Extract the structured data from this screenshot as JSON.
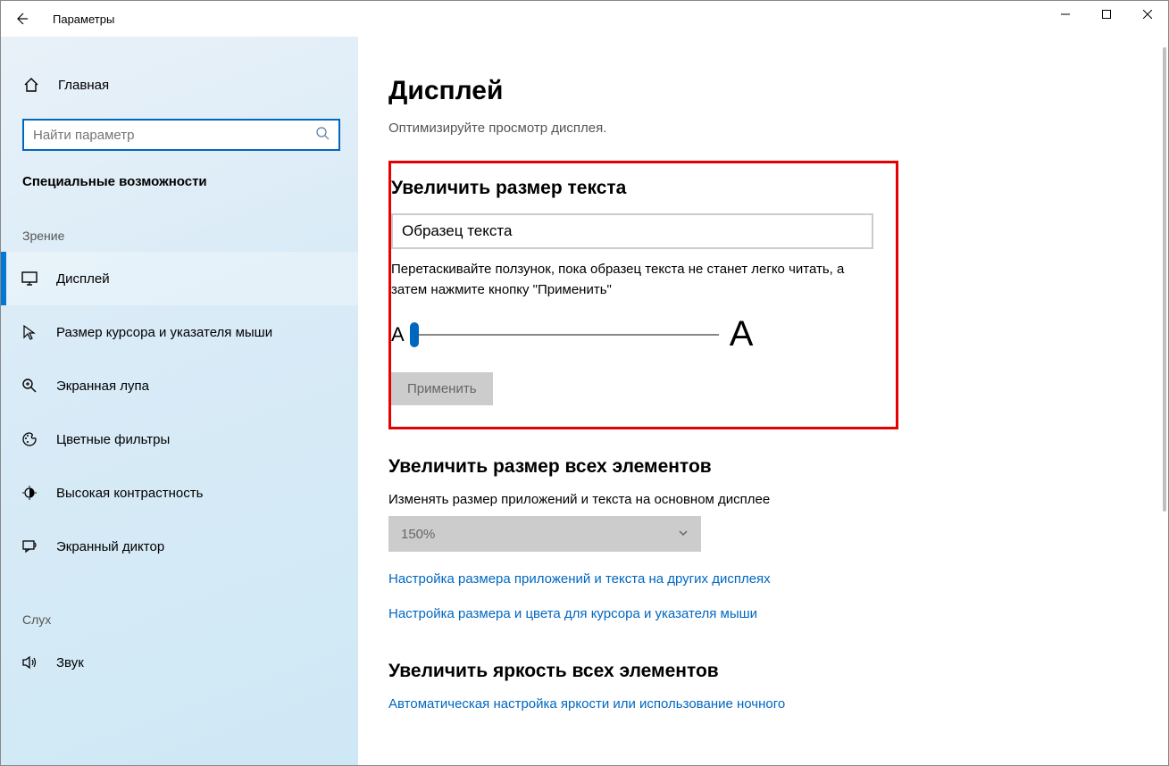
{
  "window": {
    "title": "Параметры"
  },
  "sidebar": {
    "home": "Главная",
    "search_placeholder": "Найти параметр",
    "section": "Специальные возможности",
    "groups": [
      {
        "label": "Зрение",
        "items": [
          {
            "id": "display",
            "label": "Дисплей",
            "active": true
          },
          {
            "id": "cursor",
            "label": "Размер курсора и указателя мыши"
          },
          {
            "id": "magnifier",
            "label": "Экранная лупа"
          },
          {
            "id": "colorfilters",
            "label": "Цветные фильтры"
          },
          {
            "id": "highcontrast",
            "label": "Высокая контрастность"
          },
          {
            "id": "narrator",
            "label": "Экранный диктор"
          }
        ]
      },
      {
        "label": "Слух",
        "items": [
          {
            "id": "audio",
            "label": "Звук"
          }
        ]
      }
    ]
  },
  "main": {
    "title": "Дисплей",
    "subtitle": "Оптимизируйте просмотр дисплея.",
    "text_size": {
      "heading": "Увеличить размер текста",
      "sample": "Образец текста",
      "desc": "Перетаскивайте ползунок, пока образец текста не станет легко читать, а затем нажмите кнопку \"Применить\"",
      "small_a": "A",
      "big_a": "A",
      "apply": "Применить"
    },
    "everything": {
      "heading": "Увеличить размер всех элементов",
      "label": "Изменять размер приложений и текста на основном дисплее",
      "dropdown_value": "150%",
      "link1": "Настройка размера приложений и текста на других дисплеях",
      "link2": "Настройка размера и цвета для курсора и указателя мыши"
    },
    "brightness": {
      "heading": "Увеличить яркость всех элементов",
      "link": "Автоматическая настройка яркости или использование ночного"
    }
  }
}
